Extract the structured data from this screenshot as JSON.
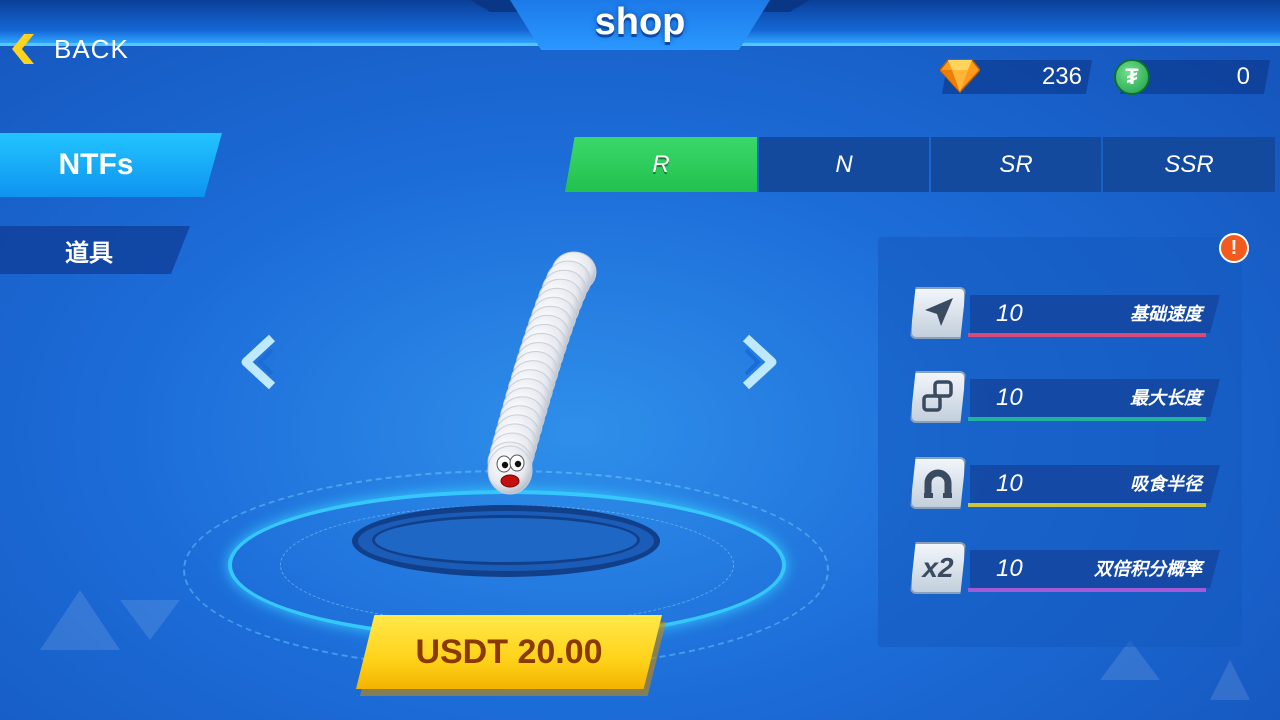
{
  "header": {
    "title": "shop"
  },
  "back": {
    "label": "BACK",
    "icon": "chevron-left-icon"
  },
  "currency": {
    "gems": {
      "value": "236",
      "icon": "gem-icon"
    },
    "usdt": {
      "value": "0",
      "icon": "usdt-icon",
      "symbol": "₮"
    }
  },
  "sidebar": {
    "items": [
      {
        "label": "NTFs",
        "active": true
      },
      {
        "label": "道具",
        "active": false
      }
    ]
  },
  "rarity_tabs": [
    {
      "label": "R",
      "active": true
    },
    {
      "label": "N",
      "active": false
    },
    {
      "label": "SR",
      "active": false
    },
    {
      "label": "SSR",
      "active": false
    }
  ],
  "price": {
    "label": "USDT 20.00"
  },
  "alert": {
    "symbol": "!"
  },
  "stats": [
    {
      "value": "10",
      "label": "基础速度",
      "icon": "arrow-cursor-icon",
      "color": "#d84a7a"
    },
    {
      "value": "10",
      "label": "最大长度",
      "icon": "link-squares-icon",
      "color": "#1fb39a"
    },
    {
      "value": "10",
      "label": "吸食半径",
      "icon": "magnet-icon",
      "color": "#c9c43a"
    },
    {
      "value": "10",
      "label": "双倍积分概率",
      "icon": "x2-icon",
      "icon_text": "x2",
      "color": "#a35ad8"
    }
  ],
  "colors": {
    "active_tab": "#22c14e",
    "accent_yellow": "#ffd21a",
    "side_active": "#22c4ff"
  }
}
